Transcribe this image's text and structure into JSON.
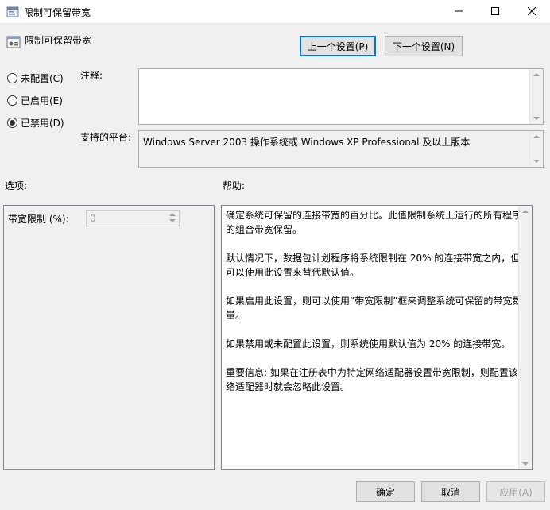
{
  "window": {
    "title": "限制可保留带宽"
  },
  "header": {
    "title": "限制可保留带宽",
    "prev_button": "上一个设置(P)",
    "next_button": "下一个设置(N)"
  },
  "state_options": [
    {
      "label": "未配置(C)",
      "checked": false
    },
    {
      "label": "已启用(E)",
      "checked": false
    },
    {
      "label": "已禁用(D)",
      "checked": true
    }
  ],
  "comment": {
    "label": "注释:",
    "value": ""
  },
  "platform": {
    "label": "支持的平台:",
    "value": "Windows Server 2003 操作系统或 Windows XP Professional 及以上版本"
  },
  "options": {
    "heading": "选项:",
    "bandwidth_label": "带宽限制 (%):",
    "bandwidth_value": "0"
  },
  "help": {
    "heading": "帮助:",
    "paragraphs": [
      "确定系统可保留的连接带宽的百分比。此值限制系统上运行的所有程序的组合带宽保留。",
      "默认情况下，数据包计划程序将系统限制在 20% 的连接带宽之内，但可以使用此设置来替代默认值。",
      "如果启用此设置，则可以使用“带宽限制”框来调整系统可保留的带宽数量。",
      "如果禁用或未配置此设置，则系统使用默认值为 20% 的连接带宽。",
      "重要信息: 如果在注册表中为特定网络适配器设置带宽限制，则配置该网络适配器时就会忽略此设置。"
    ]
  },
  "footer": {
    "ok": "确定",
    "cancel": "取消",
    "apply": "应用(A)"
  }
}
